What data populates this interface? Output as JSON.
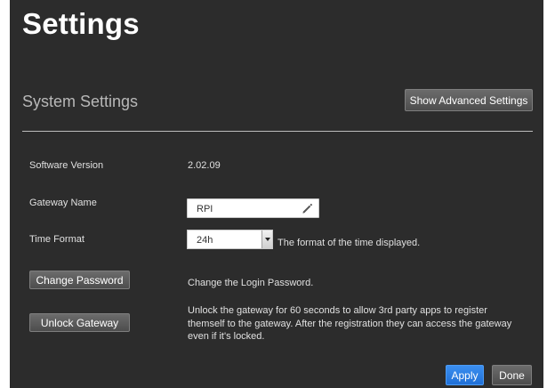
{
  "page": {
    "title": "Settings"
  },
  "section": {
    "title": "System Settings",
    "advanced_button_label": "Show Advanced Settings"
  },
  "software_version": {
    "label": "Software Version",
    "value": "2.02.09"
  },
  "gateway_name": {
    "label": "Gateway Name",
    "value": "RPI",
    "icon": "pencil-icon"
  },
  "time_format": {
    "label": "Time Format",
    "selected": "24h",
    "description": "The format of the time displayed."
  },
  "change_password": {
    "button_label": "Change Password",
    "description": "Change the Login Password."
  },
  "unlock_gateway": {
    "button_label": "Unlock Gateway",
    "description_lines": [
      "Unlock the gateway for 60 seconds to allow 3rd party apps to register",
      "themself to the gateway. After the registration they can access the gateway",
      "even if it's locked."
    ]
  },
  "footer": {
    "apply_label": "Apply",
    "done_label": "Done"
  },
  "colors": {
    "background": "#2c2c2c",
    "accent": "#2a7de1",
    "button_gray": "#5c5c5c"
  }
}
